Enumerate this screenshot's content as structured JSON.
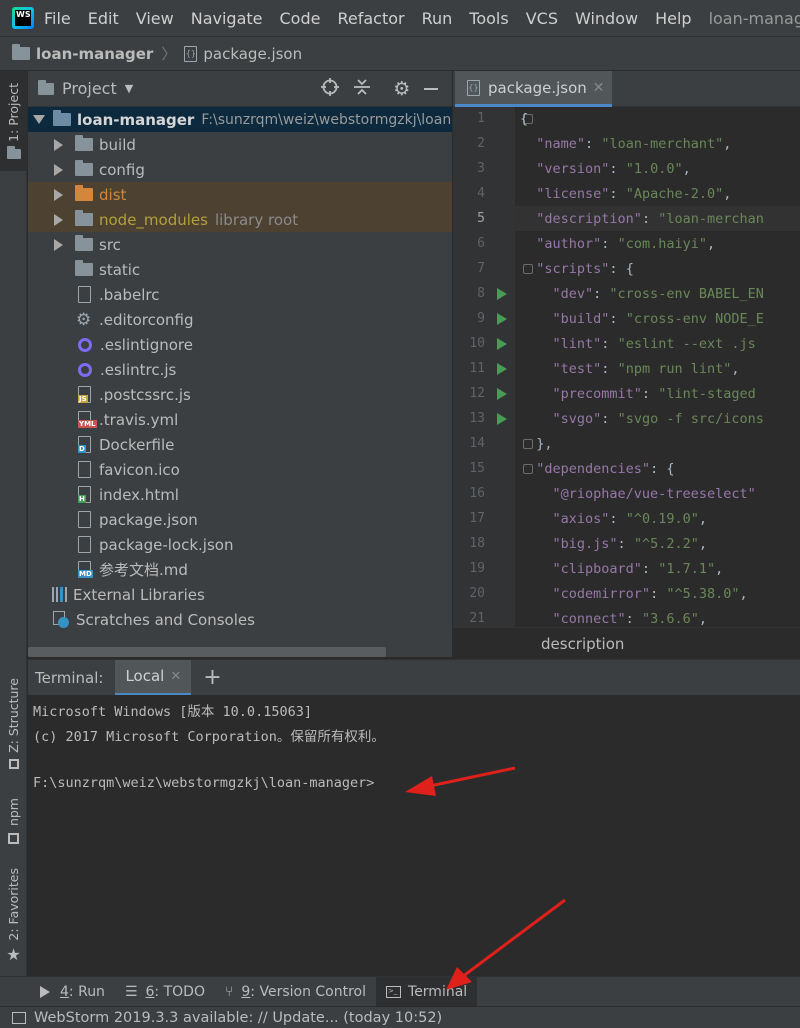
{
  "menu": {
    "logo": "WS",
    "items": [
      "File",
      "Edit",
      "View",
      "Navigate",
      "Code",
      "Refactor",
      "Run",
      "Tools",
      "VCS",
      "Window",
      "Help"
    ],
    "title": "loan-manager [F:\\"
  },
  "breadcrumb": {
    "project": "loan-manager",
    "file": "package.json"
  },
  "side_tabs": {
    "project": "1: Project",
    "structure": "Z: Structure",
    "npm": "npm",
    "favorites": "2: Favorites"
  },
  "project_panel": {
    "title": "Project",
    "root": {
      "name": "loan-manager",
      "path": "F:\\sunzrqm\\weiz\\webstormgzkj\\loan"
    },
    "items": [
      {
        "name": "build",
        "kind": "folder"
      },
      {
        "name": "config",
        "kind": "folder"
      },
      {
        "name": "dist",
        "kind": "folder-excluded"
      },
      {
        "name": "node_modules",
        "kind": "folder-library",
        "note": "library root"
      },
      {
        "name": "src",
        "kind": "folder"
      },
      {
        "name": "static",
        "kind": "folder"
      },
      {
        "name": ".babelrc",
        "kind": "json"
      },
      {
        "name": ".editorconfig",
        "kind": "config"
      },
      {
        "name": ".eslintignore",
        "kind": "eslint"
      },
      {
        "name": ".eslintrc.js",
        "kind": "eslint"
      },
      {
        "name": ".postcssrc.js",
        "kind": "js"
      },
      {
        "name": ".travis.yml",
        "kind": "yml"
      },
      {
        "name": "Dockerfile",
        "kind": "docker"
      },
      {
        "name": "favicon.ico",
        "kind": "image"
      },
      {
        "name": "index.html",
        "kind": "html"
      },
      {
        "name": "package.json",
        "kind": "json"
      },
      {
        "name": "package-lock.json",
        "kind": "json"
      },
      {
        "name": "参考文档.md",
        "kind": "md"
      }
    ],
    "external": "External Libraries",
    "scratches": "Scratches and Consoles"
  },
  "editor": {
    "tab": "package.json",
    "current_line": 5,
    "lines": [
      {
        "n": "1",
        "k": "",
        "sep": "",
        "v": "",
        "raw": "{"
      },
      {
        "n": "2",
        "k": "\"name\"",
        "sep": ": ",
        "v": "\"loan-merchant\"",
        "tail": ","
      },
      {
        "n": "3",
        "k": "\"version\"",
        "sep": ": ",
        "v": "\"1.0.0\"",
        "tail": ","
      },
      {
        "n": "4",
        "k": "\"license\"",
        "sep": ": ",
        "v": "\"Apache-2.0\"",
        "tail": ","
      },
      {
        "n": "5",
        "k": "\"description\"",
        "sep": ": ",
        "v": "\"loan-merchan",
        "tail": ""
      },
      {
        "n": "6",
        "k": "\"author\"",
        "sep": ": ",
        "v": "\"com.haiyi\"",
        "tail": ","
      },
      {
        "n": "7",
        "k": "\"scripts\"",
        "sep": ": ",
        "v": "",
        "tail": "{"
      },
      {
        "n": "8",
        "k": "\"dev\"",
        "sep": ": ",
        "v": "\"cross-env BABEL_EN",
        "tail": ""
      },
      {
        "n": "9",
        "k": "\"build\"",
        "sep": ": ",
        "v": "\"cross-env NODE_E",
        "tail": ""
      },
      {
        "n": "10",
        "k": "\"lint\"",
        "sep": ": ",
        "v": "\"eslint --ext .js",
        "tail": ""
      },
      {
        "n": "11",
        "k": "\"test\"",
        "sep": ": ",
        "v": "\"npm run lint\"",
        "tail": ","
      },
      {
        "n": "12",
        "k": "\"precommit\"",
        "sep": ": ",
        "v": "\"lint-staged",
        "tail": ""
      },
      {
        "n": "13",
        "k": "\"svgo\"",
        "sep": ": ",
        "v": "\"svgo -f src/icons",
        "tail": ""
      },
      {
        "n": "14",
        "k": "",
        "sep": "",
        "v": "",
        "raw": "},"
      },
      {
        "n": "15",
        "k": "\"dependencies\"",
        "sep": ": ",
        "v": "",
        "tail": "{"
      },
      {
        "n": "16",
        "k": "\"@riophae/vue-treeselect\"",
        "sep": "",
        "v": "",
        "tail": ""
      },
      {
        "n": "17",
        "k": "\"axios\"",
        "sep": ": ",
        "v": "\"^0.19.0\"",
        "tail": ","
      },
      {
        "n": "18",
        "k": "\"big.js\"",
        "sep": ": ",
        "v": "\"^5.2.2\"",
        "tail": ","
      },
      {
        "n": "19",
        "k": "\"clipboard\"",
        "sep": ": ",
        "v": "\"1.7.1\"",
        "tail": ","
      },
      {
        "n": "20",
        "k": "\"codemirror\"",
        "sep": ": ",
        "v": "\"^5.38.0\"",
        "tail": ","
      },
      {
        "n": "21",
        "k": "\"connect\"",
        "sep": ": ",
        "v": "\"3.6.6\"",
        "tail": ","
      }
    ],
    "status_path": "description"
  },
  "terminal": {
    "label": "Terminal:",
    "tab": "Local",
    "lines": [
      "Microsoft Windows [版本 10.0.15063]",
      "(c) 2017 Microsoft Corporation。保留所有权利。",
      "",
      "F:\\sunzrqm\\weiz\\webstormgzkj\\loan-manager>"
    ]
  },
  "bottom_tabs": [
    {
      "key": "4",
      "label": ": Run"
    },
    {
      "key": "6",
      "label": ": TODO"
    },
    {
      "key": "9",
      "label": ": Version Control"
    },
    {
      "key": "",
      "label": "Terminal"
    }
  ],
  "status": "WebStorm 2019.3.3 available: // Update... (today 10:52)",
  "colors": {
    "arrow": "#e0201b",
    "selection": "#0d293e",
    "excluded": "#d2873b"
  }
}
